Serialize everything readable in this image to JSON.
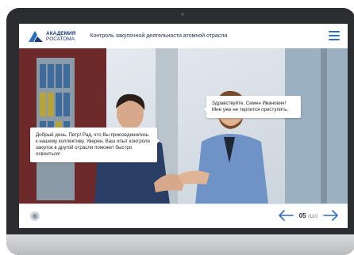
{
  "header": {
    "logo_line1": "АКАДЕМИЯ",
    "logo_line2": "РОСАТОМА",
    "course_title": "Контроль закупочной деятельности атомной отрасли"
  },
  "dialogue": {
    "left_bubble": "Добрый день, Петр! Рад, что Вы присоединились к нашему коллективу. Уверен, Ваш опыт контроля закупок в другой отрасли поможет быстро освоиться!",
    "right_bubble": "Здравствуйте, Семен Иванович! Мне уже не терпится приступить."
  },
  "pager": {
    "current": "05",
    "total": "/110"
  },
  "icons": {
    "menu": "hamburger-menu-icon",
    "prev": "arrow-left-icon",
    "next": "arrow-right-icon",
    "round": "info-circle-icon"
  },
  "colors": {
    "accent": "#2d6fbd",
    "brand": "#1b3b73"
  }
}
